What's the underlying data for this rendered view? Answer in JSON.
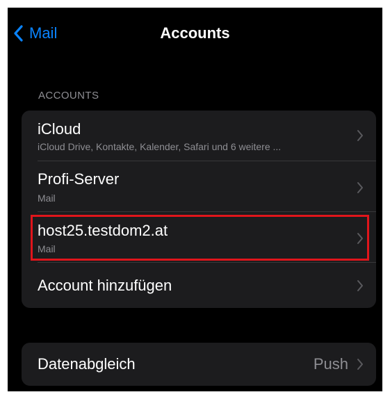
{
  "nav": {
    "back_label": "Mail",
    "title": "Accounts"
  },
  "accounts_section": {
    "header": "ACCOUNTS",
    "items": [
      {
        "name": "iCloud",
        "subtitle": "iCloud Drive, Kontakte, Kalender, Safari und 6 weitere ..."
      },
      {
        "name": "Profi-Server",
        "subtitle": "Mail"
      },
      {
        "name": "host25.testdom2.at",
        "subtitle": "Mail"
      },
      {
        "name": "Account hinzufügen"
      }
    ]
  },
  "fetch_section": {
    "label": "Datenabgleich",
    "value": "Push"
  },
  "colors": {
    "accent": "#0a84ff",
    "highlight_border": "#e0151b",
    "cell_background": "#1c1c1e",
    "secondary_text": "#8e8e93"
  },
  "icons": [
    "chevron-left-icon",
    "chevron-right-icon"
  ]
}
